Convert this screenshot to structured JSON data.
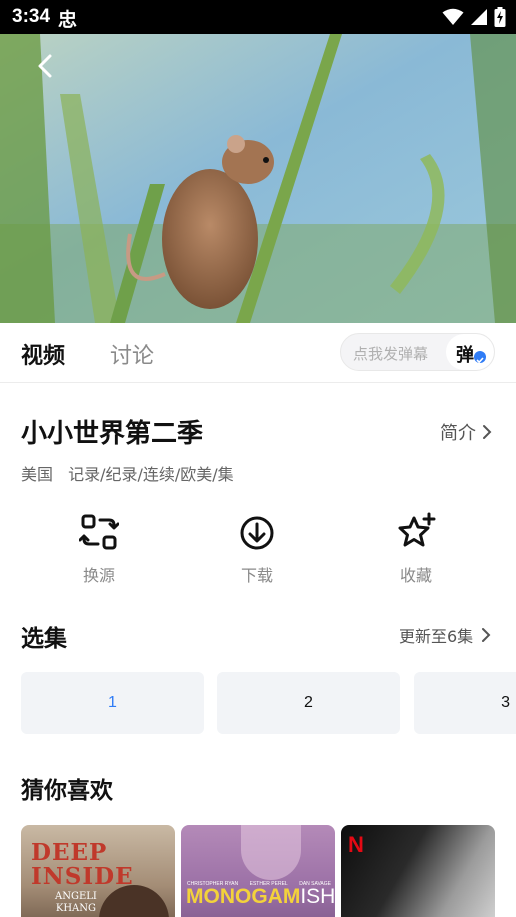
{
  "status_bar": {
    "time": "3:34",
    "notification_glyph": "忠",
    "icons": [
      "wifi-icon",
      "signal-icon",
      "battery-charging-icon"
    ]
  },
  "player": {
    "back_icon": "chevron-left-icon"
  },
  "tabs": {
    "items": [
      {
        "label": "视频",
        "active": true
      },
      {
        "label": "讨论",
        "active": false
      }
    ]
  },
  "danmu": {
    "placeholder": "点我发弹幕",
    "toggle_label": "弹"
  },
  "show": {
    "title": "小小世界第二季",
    "intro_label": "简介",
    "region": "美国",
    "tags": "记录/纪录/连续/欧美/集"
  },
  "actions": [
    {
      "label": "换源",
      "icon": "switch-source-icon"
    },
    {
      "label": "下载",
      "icon": "download-icon"
    },
    {
      "label": "收藏",
      "icon": "star-add-icon"
    }
  ],
  "episodes": {
    "title": "选集",
    "more_label": "更新至6集",
    "items": [
      "1",
      "2",
      "3"
    ],
    "selected": "1"
  },
  "recommendations": {
    "title": "猜你喜欢",
    "posters": [
      {
        "title_line1": "DEEP",
        "title_line2": "INSIDE",
        "subtitle_line1": "ANGELI",
        "subtitle_line2": "KHANG"
      },
      {
        "credit1": "CHRISTOPHER RYAN",
        "credit2": "ESTHER PEREL",
        "credit3": "DAN SAVAGE",
        "title_main": "MONOGAM",
        "title_suffix": "ISH"
      },
      {
        "logo": "N"
      }
    ]
  },
  "colors": {
    "accent": "#2f7cf6",
    "episode_bg": "#f2f4f7",
    "muted_text": "#8a8a8a"
  }
}
